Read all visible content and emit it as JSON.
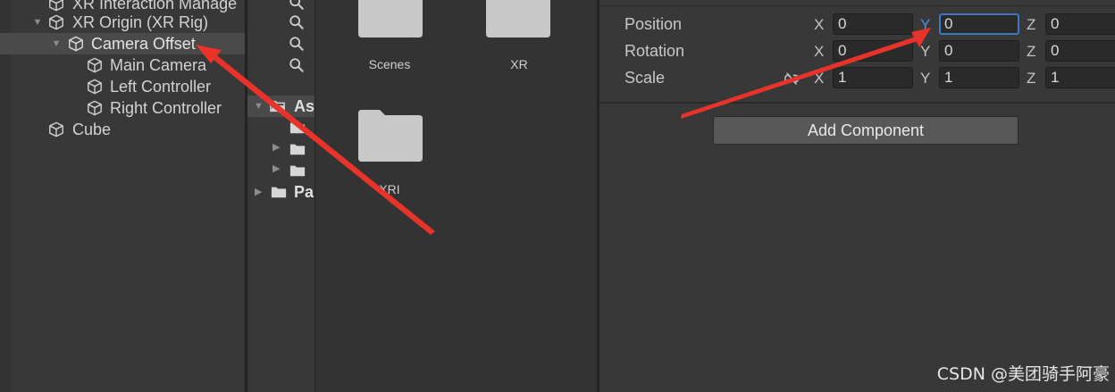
{
  "hierarchy": {
    "items": [
      {
        "label": "XR Interaction Manage",
        "indent": 1,
        "arrow": ""
      },
      {
        "label": "XR Origin (XR Rig)",
        "indent": 1,
        "arrow": "▼"
      },
      {
        "label": "Camera Offset",
        "indent": 2,
        "arrow": "▼",
        "selected": true
      },
      {
        "label": "Main Camera",
        "indent": 3,
        "arrow": ""
      },
      {
        "label": "Left Controller",
        "indent": 3,
        "arrow": ""
      },
      {
        "label": "Right Controller",
        "indent": 3,
        "arrow": ""
      },
      {
        "label": "Cube",
        "indent": 1,
        "arrow": ""
      }
    ]
  },
  "project_tree": {
    "assets_label": "As",
    "packages_label": "Pa"
  },
  "project_files": {
    "folders": [
      {
        "label": "Scenes"
      },
      {
        "label": "XR"
      },
      {
        "label": "XRI"
      }
    ]
  },
  "inspector": {
    "rows": [
      {
        "label": "Position",
        "x": "0",
        "y": "0",
        "z": "0"
      },
      {
        "label": "Rotation",
        "x": "0",
        "y": "0",
        "z": "0"
      },
      {
        "label": "Scale",
        "x": "1",
        "y": "1",
        "z": "1"
      }
    ],
    "axis_x": "X",
    "axis_y": "Y",
    "axis_z": "Z",
    "add_component_label": "Add Component",
    "scale_link_icon": "constrain-proportions-icon"
  },
  "watermark": "CSDN @美团骑手阿豪",
  "colors": {
    "annotation_arrow": "#e8332a",
    "focus_accent": "#3b78c2",
    "selection_bg": "#4a4a4a"
  }
}
